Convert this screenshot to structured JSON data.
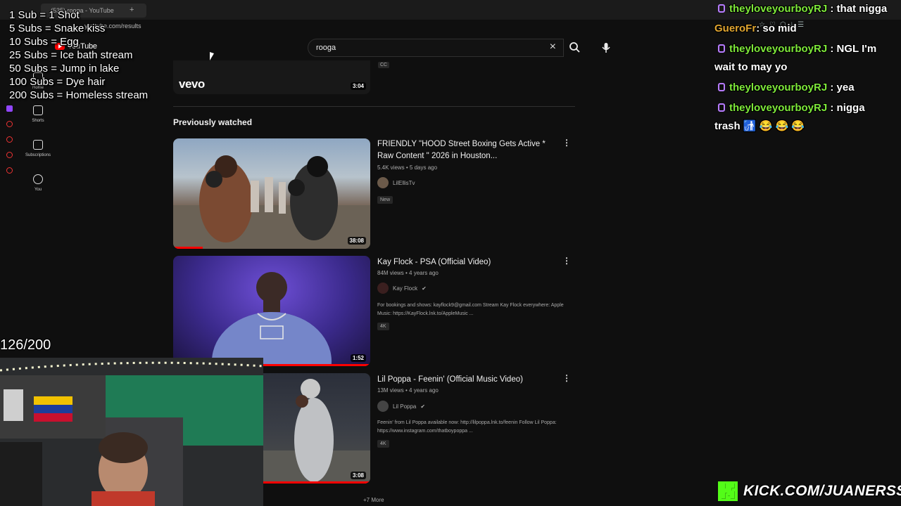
{
  "browser": {
    "tab_title": "(535) rooga - YouTube",
    "url": "youtube.com/results"
  },
  "youtube": {
    "logo_text": "YouTube",
    "sidebar": [
      {
        "label": "Home",
        "icon": "home-icon"
      },
      {
        "label": "Shorts",
        "icon": "shorts-icon"
      },
      {
        "label": "Subscriptions",
        "icon": "subscriptions-icon"
      },
      {
        "label": "You",
        "icon": "you-icon"
      }
    ],
    "search": {
      "query": "rooga"
    },
    "top_result": {
      "brand": "vevo",
      "duration": "3:04",
      "badge": "CC"
    },
    "section_title": "Previously watched",
    "videos": [
      {
        "title": "FRIENDLY \"HOOD Street Boxing Gets Active * Raw Content \" 2026 in Houston...",
        "meta": "5.4K views • 5 days ago",
        "channel": "LilEllisTv",
        "verified": false,
        "description": "",
        "badge": "New",
        "duration": "38:08",
        "watched_fraction": 0.15
      },
      {
        "title": "Kay Flock - PSA (Official Video)",
        "meta": "84M views • 4 years ago",
        "channel": "Kay Flock",
        "verified": true,
        "description": "For bookings and shows: kayflock9@gmail.com Stream Kay Flock everywhere: Apple Music: https://KayFlock.lnk.to/AppleMusic ...",
        "badge": "4K",
        "duration": "1:52",
        "watched_fraction": 1.0
      },
      {
        "title": "Lil Poppa - Feenin' (Official Music Video)",
        "meta": "13M views • 4 years ago",
        "channel": "Lil Poppa",
        "verified": true,
        "description": "Feenin' from Lil Poppa available now: http://lilpoppa.lnk.to/feenin Follow Lil Poppa: https://www.instagram.com/thatboypoppa ...",
        "badge": "4K",
        "duration": "3:08",
        "watched_fraction": 1.0
      }
    ],
    "more_link": "+7 More"
  },
  "overlay": {
    "goals": [
      "1 Sub = 1 Shot",
      "5 Subs = Snake kiss",
      "10 Subs = Egg",
      "25 Subs = Ice bath stream",
      "50 Subs = Jump in lake",
      "100 Subs = Dye hair",
      "200 Subs = Homeless stream"
    ],
    "sub_count": "126/200",
    "kick_url": "KICK.COM/JUANERSSS"
  },
  "chat": [
    {
      "user": "theyloveyourboyRJ",
      "user_color": "#7ee83a",
      "badge": true,
      "msg": " : that nigga"
    },
    {
      "user": "GueroFr",
      "user_color": "#e0a530",
      "badge": false,
      "msg": ": so mid"
    },
    {
      "user": "theyloveyourboyRJ",
      "user_color": "#7ee83a",
      "badge": true,
      "msg": " : NGL I'm"
    },
    {
      "user": "",
      "user_color": "#fff",
      "badge": false,
      "msg": "wait to may yo"
    },
    {
      "user": "theyloveyourboyRJ",
      "user_color": "#7ee83a",
      "badge": true,
      "msg": " : yea"
    },
    {
      "user": "theyloveyourboyRJ",
      "user_color": "#7ee83a",
      "badge": true,
      "msg": " : nigga"
    },
    {
      "user": "",
      "user_color": "#fff",
      "badge": false,
      "msg": "trash 🚮 😂 😂 😂"
    }
  ],
  "colors": {
    "youtube_red": "#ff0000",
    "kick_green": "#53fc18",
    "chat_badge": "#b77bff"
  }
}
